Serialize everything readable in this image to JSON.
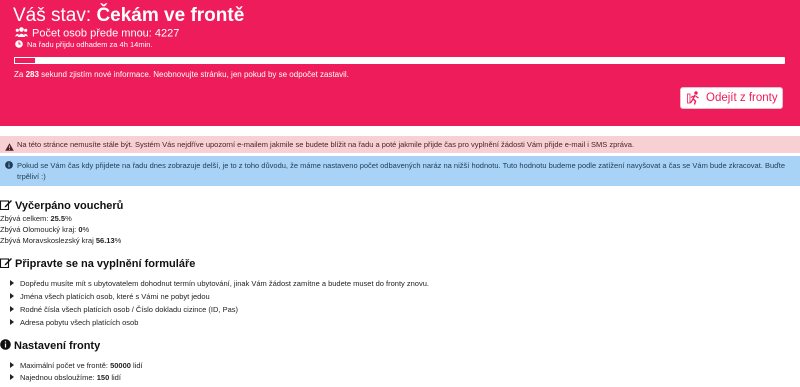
{
  "header": {
    "status_prefix": "Váš stav:",
    "status_value": "Čekám ve frontě",
    "queue_text": "Počet osob přede mnou: 4227",
    "eta_text": "Na řadu přijdu odhadem za 4h 14min.",
    "progress_fraction": 0.028,
    "refresh_before": "Za",
    "refresh_seconds": "283",
    "refresh_after": "sekund zjistím nové informace. Neobnovujte stránku, jen pokud by se odpočet zastavil.",
    "leave_button": "Odejít z fronty",
    "accent_color": "#ee1c5b"
  },
  "alerts": {
    "danger_text": "Na této stránce nemusíte stále být. Systém Vás nejdříve upozorní e-mailem jakmile se budete blížit na řadu a poté jakmile přijde čas pro vyplnění žádosti Vám přijde e-mail i SMS zpráva.",
    "info_text": "Pokud se Vám čas kdy přijdete na řadu dnes zobrazuje delší, je to z toho důvodu, že máme nastaveno počet odbavených naráz na nižší hodnotu. Tuto hodnotu budeme podle zatížení navyšovat a čas se Vám bude zkracovat. Buďte trpěliví :)"
  },
  "vouchers": {
    "title": "Vyčerpáno voucherů",
    "rows": [
      {
        "label": "Zbývá celkem:",
        "value": "25.5",
        "unit": "%"
      },
      {
        "label": "Zbývá Olomoucký kraj:",
        "value": "0",
        "unit": "%"
      },
      {
        "label": "Zbývá Moravskoslezský kraj",
        "value": "56.13",
        "unit": "%"
      }
    ]
  },
  "prepare": {
    "title": "Připravte se na vyplnění formuláře",
    "items": [
      "Dopředu musíte mít s ubytovatelem dohodnut termín ubytování, jinak Vám žádost zamítne a budete muset do fronty znovu.",
      "Jména všech platících osob, které s Vámi ne pobyt jedou",
      "Rodné čísla všech platících osob / Číslo dokladu cizince (ID, Pas)",
      "Adresa pobytu všech platících osob"
    ]
  },
  "queue_settings": {
    "title": "Nastavení fronty",
    "items": [
      {
        "label": "Maximální počet ve frontě:",
        "value": "50000",
        "unit": "lidí"
      },
      {
        "label": "Najednou obsloužíme:",
        "value": "150",
        "unit": "lidí"
      }
    ]
  },
  "icons": {
    "queue": "users-icon",
    "eta": "clock-icon",
    "leave": "running-person-icon",
    "danger": "warning-icon",
    "info": "info-circle-icon",
    "vouchers": "edit-icon",
    "prepare": "edit-icon",
    "settings": "info-circle-icon"
  }
}
